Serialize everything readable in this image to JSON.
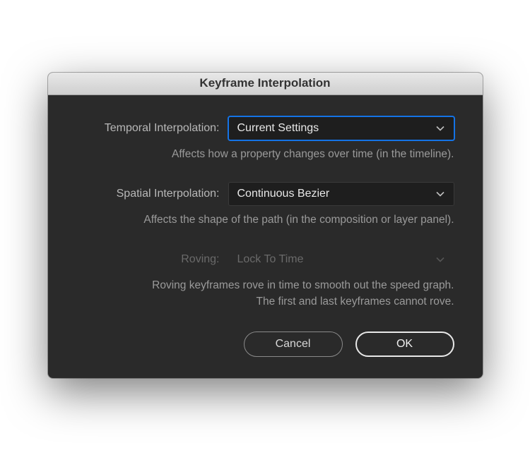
{
  "dialog": {
    "title": "Keyframe Interpolation"
  },
  "temporal": {
    "label": "Temporal Interpolation:",
    "value": "Current Settings",
    "help": "Affects how a property changes over time (in the timeline)."
  },
  "spatial": {
    "label": "Spatial Interpolation:",
    "value": "Continuous Bezier",
    "help": "Affects the shape of the path (in the composition or layer panel)."
  },
  "roving": {
    "label": "Roving:",
    "value": "Lock To Time",
    "help_line1": "Roving keyframes rove in time to smooth out the speed graph.",
    "help_line2": "The first and last keyframes cannot rove."
  },
  "buttons": {
    "cancel": "Cancel",
    "ok": "OK"
  }
}
